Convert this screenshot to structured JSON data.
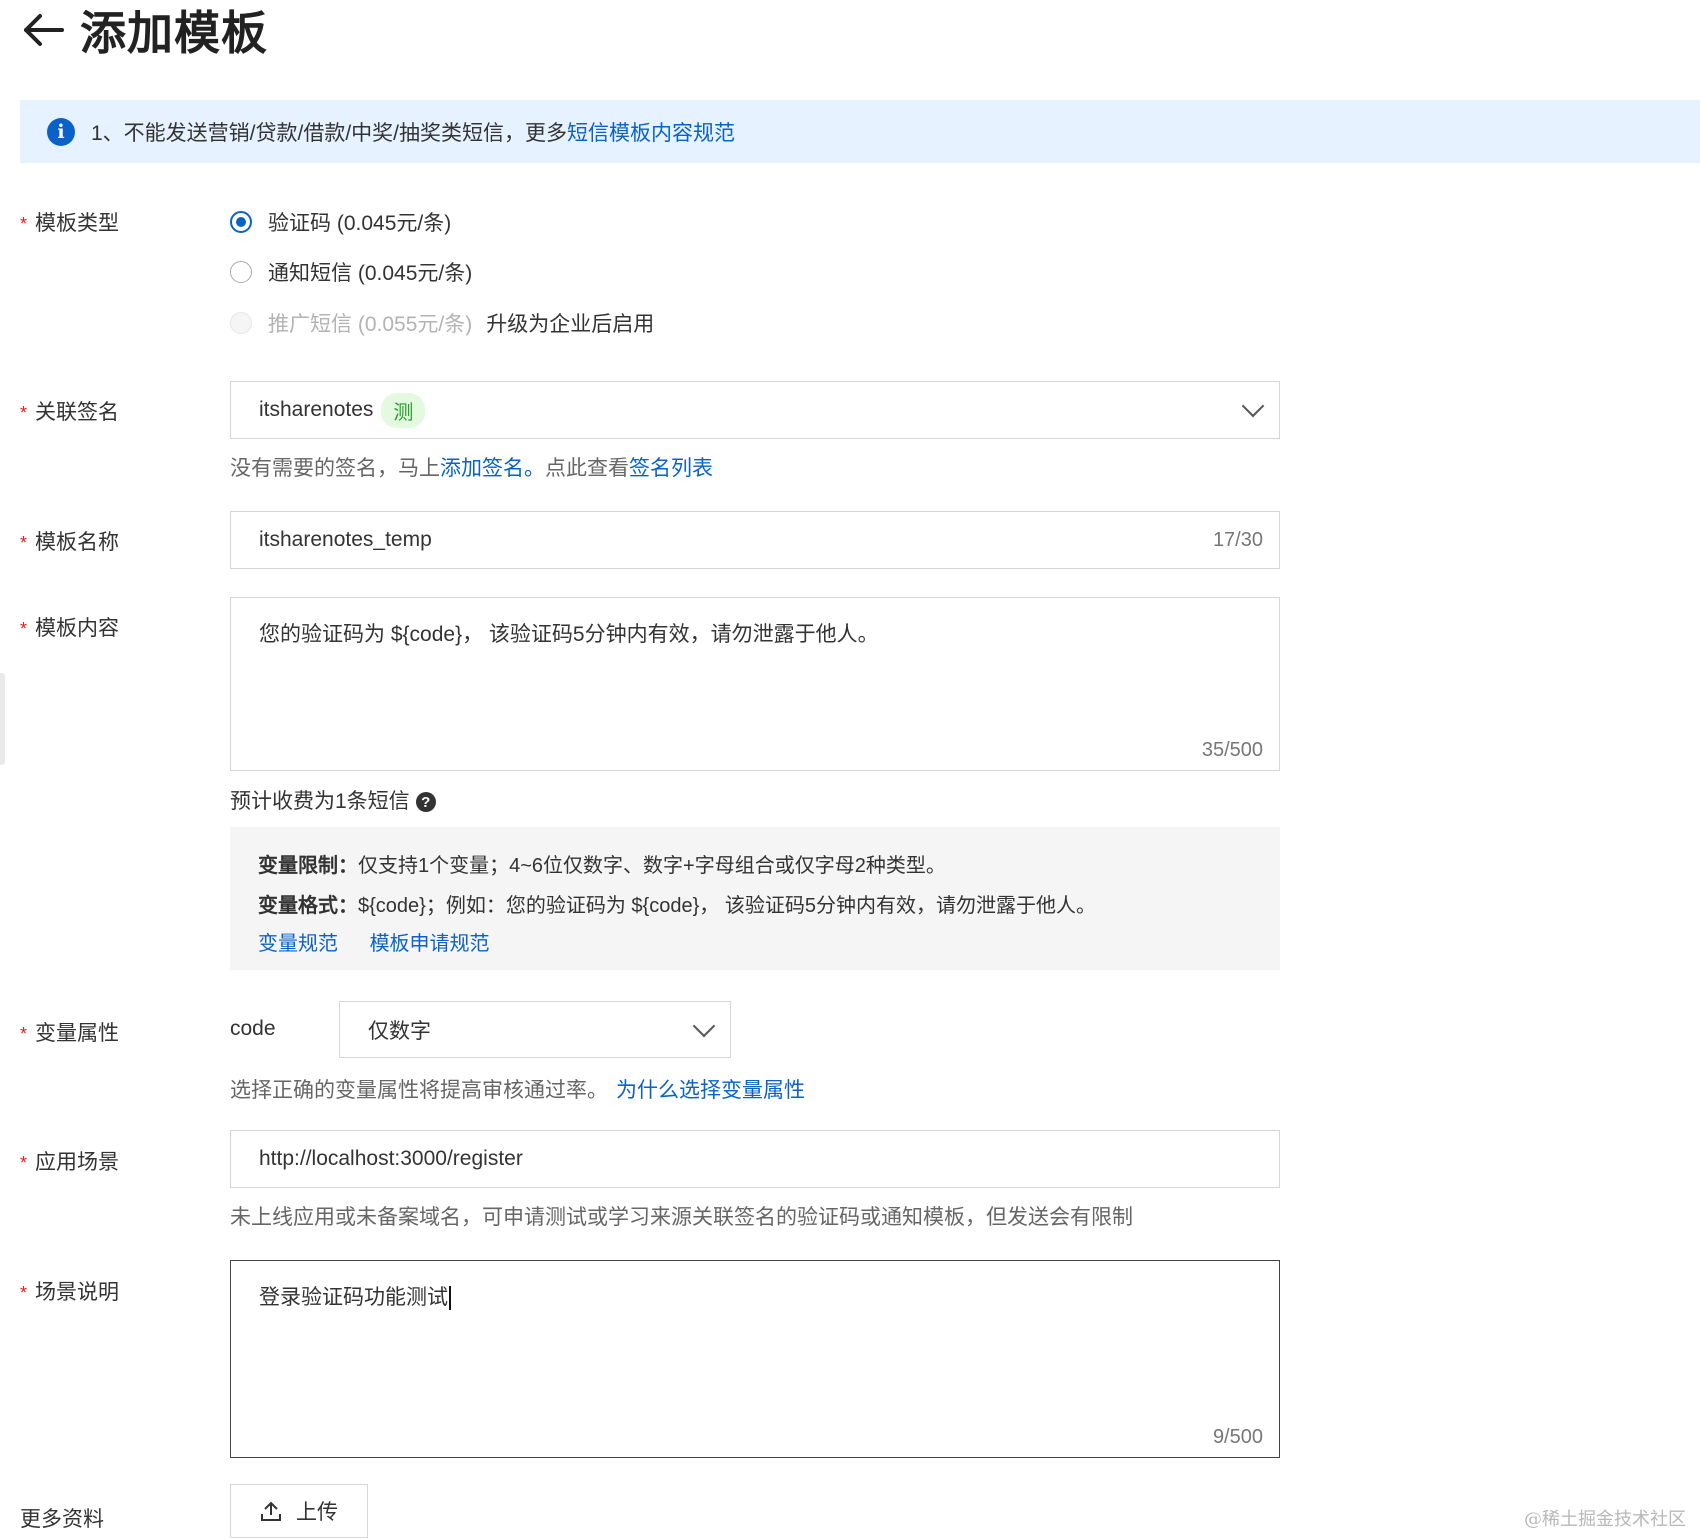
{
  "header": {
    "title": "添加模板"
  },
  "notice": {
    "text": "1、不能发送营销/贷款/借款/中奖/抽奖类短信，更多",
    "link": "短信模板内容规范"
  },
  "template_type": {
    "label": "模板类型",
    "options": [
      {
        "label": "验证码 (0.045元/条)",
        "checked": true,
        "disabled": false
      },
      {
        "label": "通知短信 (0.045元/条)",
        "checked": false,
        "disabled": false
      },
      {
        "label": "推广短信 (0.055元/条)",
        "checked": false,
        "disabled": true,
        "note": "升级为企业后启用"
      }
    ]
  },
  "signature": {
    "label": "关联签名",
    "value": "itsharenotes",
    "tag": "测",
    "help_prefix": "没有需要的签名，马上",
    "help_link1": "添加签名。",
    "help_middle": "点此查看",
    "help_link2": "签名列表"
  },
  "template_name": {
    "label": "模板名称",
    "value": "itsharenotes_temp",
    "counter": "17/30"
  },
  "template_content": {
    "label": "模板内容",
    "value": "您的验证码为 ${code}， 该验证码5分钟内有效，请勿泄露于他人。",
    "counter": "35/500",
    "fee_note": "预计收费为1条短信",
    "fee_help_icon": "?"
  },
  "variable_info": {
    "limit_label": "变量限制：",
    "limit_text": "仅支持1个变量；4~6位仅数字、数字+字母组合或仅字母2种类型。",
    "format_label": "变量格式：",
    "format_text": "${code}；例如：您的验证码为 ${code}， 该验证码5分钟内有效，请勿泄露于他人。",
    "link1": "变量规范",
    "link2": "模板申请规范"
  },
  "variable_attr": {
    "label": "变量属性",
    "var_name": "code",
    "select_value": "仅数字",
    "help_text": "选择正确的变量属性将提高审核通过率。",
    "help_link": "为什么选择变量属性"
  },
  "scenario": {
    "label": "应用场景",
    "value": "http://localhost:3000/register",
    "help_text": "未上线应用或未备案域名，可申请测试或学习来源关联签名的验证码或通知模板，但发送会有限制"
  },
  "scenario_desc": {
    "label": "场景说明",
    "value": "登录验证码功能测试",
    "counter": "9/500"
  },
  "more_docs": {
    "label": "更多资料",
    "upload_label": "上传"
  },
  "watermark": "@稀土掘金技术社区",
  "colors": {
    "accent": "#0a62c9",
    "required": "#e02020",
    "notice_bg": "#e6f2ff",
    "tag_bg": "#e3f9e0",
    "tag_text": "#2b9f2b"
  }
}
